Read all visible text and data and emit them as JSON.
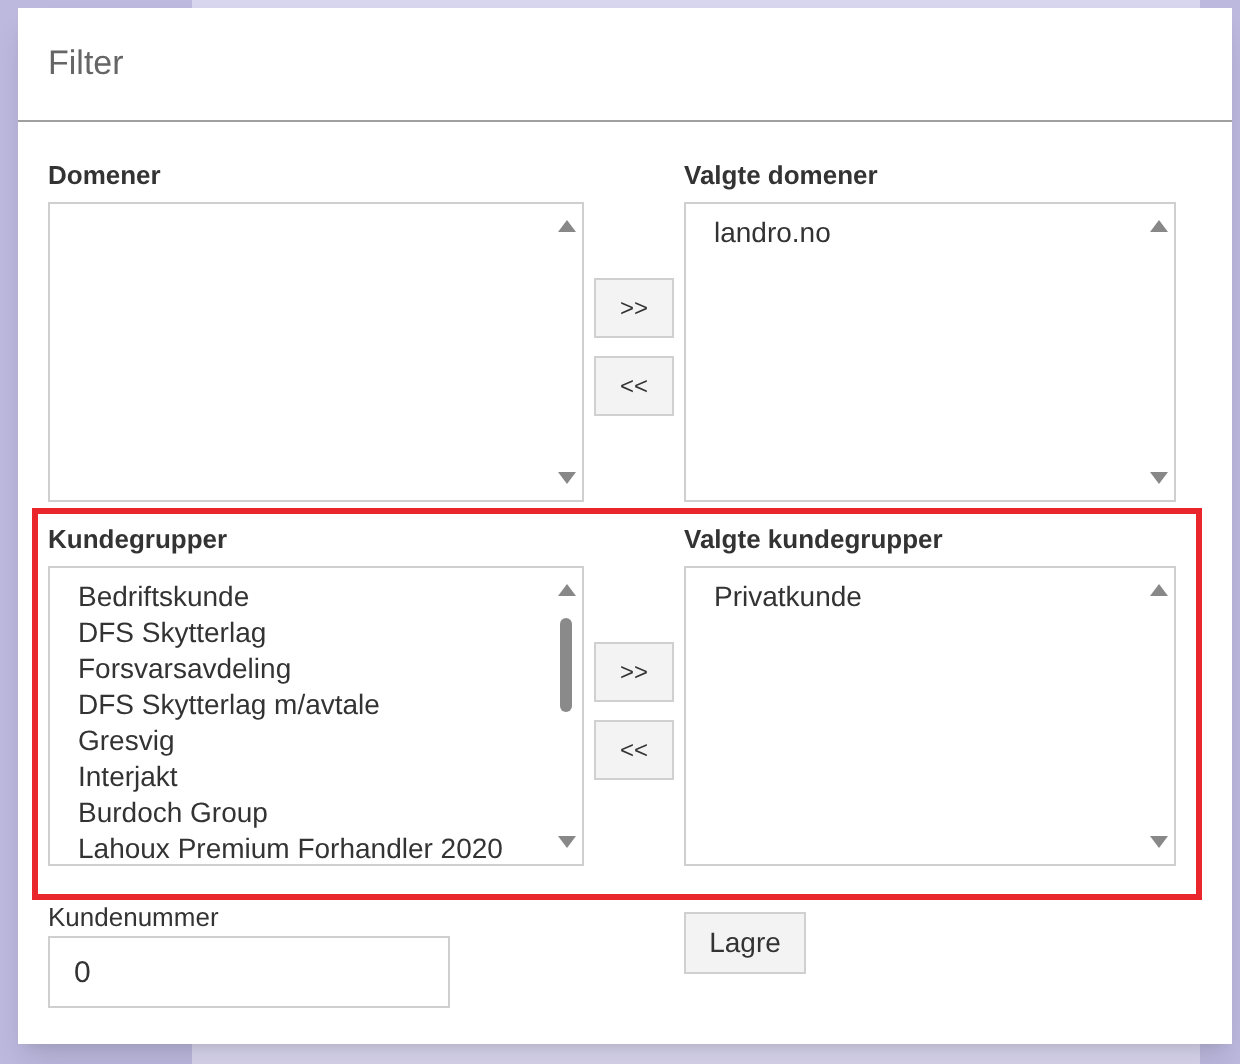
{
  "dialog": {
    "title": "Filter"
  },
  "sections": [
    {
      "label": "Domener",
      "chosen_label": "Valgte domener",
      "chosen_items": [
        "landro.no"
      ],
      "move_buttons": [
        ">>",
        "<<"
      ],
      "highlighted": false
    },
    {
      "label": "Kundegrupper",
      "items": [
        "Bedriftskunde",
        "DFS Skytterlag",
        "Forsvarsavdeling",
        "DFS Skytterlag m/avtale",
        "Gresvig",
        "Interjakt",
        "Burdoch Group",
        "Lahoux Premium Forhandler 2020"
      ],
      "chosen_label": "Valgte kundegrupper",
      "chosen_items": [
        "Privatkunde"
      ],
      "move_buttons": [
        ">>",
        "<<"
      ],
      "highlighted": true
    }
  ],
  "customer_number": {
    "label": "Kundenummer",
    "value": "0"
  },
  "save_button": "Lagre"
}
